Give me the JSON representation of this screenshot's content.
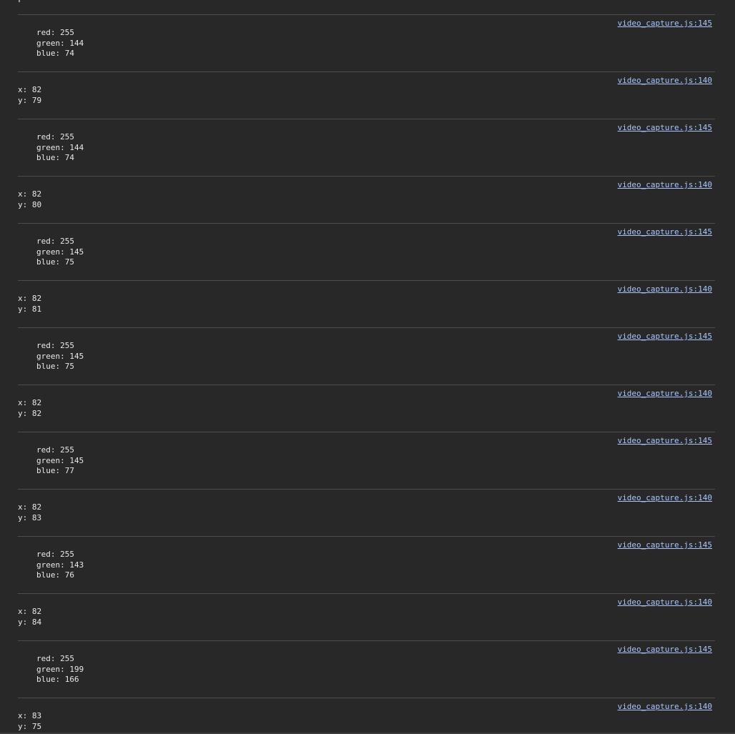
{
  "console": {
    "entries": [
      {
        "kind": "rgb",
        "source": "video_capture.js:145",
        "red": "red: 255",
        "green": "green: 144",
        "blue": "blue: 74"
      },
      {
        "kind": "xy",
        "source": "video_capture.js:140",
        "x": "x: 82",
        "y": "y: 79"
      },
      {
        "kind": "rgb",
        "source": "video_capture.js:145",
        "red": "red: 255",
        "green": "green: 144",
        "blue": "blue: 74"
      },
      {
        "kind": "xy",
        "source": "video_capture.js:140",
        "x": "x: 82",
        "y": "y: 80"
      },
      {
        "kind": "rgb",
        "source": "video_capture.js:145",
        "red": "red: 255",
        "green": "green: 145",
        "blue": "blue: 75"
      },
      {
        "kind": "xy",
        "source": "video_capture.js:140",
        "x": "x: 82",
        "y": "y: 81"
      },
      {
        "kind": "rgb",
        "source": "video_capture.js:145",
        "red": "red: 255",
        "green": "green: 145",
        "blue": "blue: 75"
      },
      {
        "kind": "xy",
        "source": "video_capture.js:140",
        "x": "x: 82",
        "y": "y: 82"
      },
      {
        "kind": "rgb",
        "source": "video_capture.js:145",
        "red": "red: 255",
        "green": "green: 145",
        "blue": "blue: 77"
      },
      {
        "kind": "xy",
        "source": "video_capture.js:140",
        "x": "x: 82",
        "y": "y: 83"
      },
      {
        "kind": "rgb",
        "source": "video_capture.js:145",
        "red": "red: 255",
        "green": "green: 143",
        "blue": "blue: 76"
      },
      {
        "kind": "xy",
        "source": "video_capture.js:140",
        "x": "x: 82",
        "y": "y: 84"
      },
      {
        "kind": "rgb",
        "source": "video_capture.js:145",
        "red": "red: 255",
        "green": "green: 199",
        "blue": "blue: 166"
      },
      {
        "kind": "xy",
        "source": "video_capture.js:140",
        "x": "x: 83",
        "y": "y: 75"
      }
    ]
  },
  "colors": {
    "background": "#282828",
    "text": "#e8e8e8",
    "link": "#a8c7fa",
    "divider": "#4d4d4d"
  }
}
